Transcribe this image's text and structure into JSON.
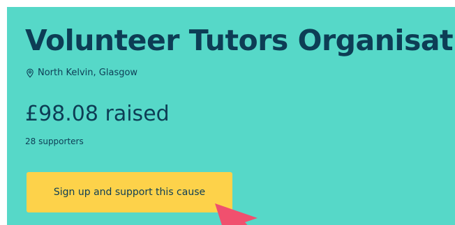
{
  "cause": {
    "title": "Volunteer Tutors Organisation",
    "location_icon": "map-pin-icon",
    "location": "North Kelvin, Glasgow",
    "raised": "£98.08 raised",
    "supporters": "28 supporters",
    "cta_label": "Sign up and support this cause"
  },
  "colors": {
    "background": "#56d8c8",
    "text": "#0d3d55",
    "button": "#fdd24a",
    "cursor": "#f0506e"
  }
}
